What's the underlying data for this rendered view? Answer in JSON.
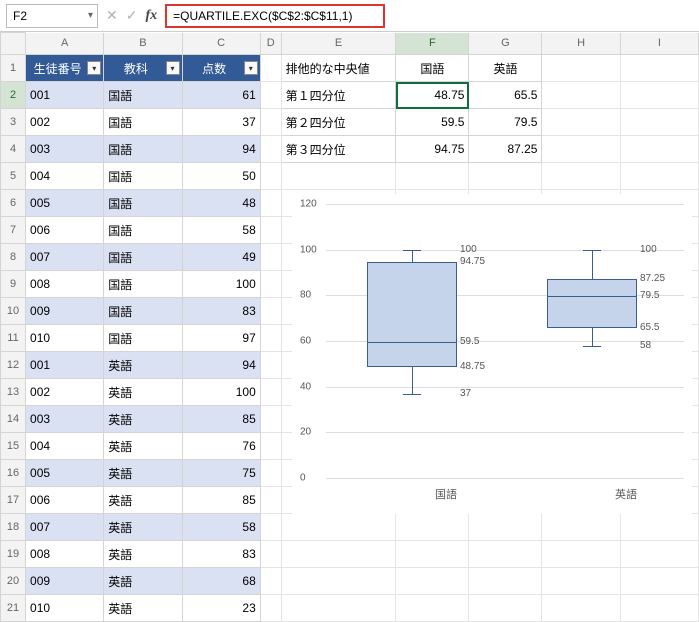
{
  "name_box": "F2",
  "formula": "=QUARTILE.EXC($C$2:$C$11,1)",
  "col_headers": [
    "A",
    "B",
    "C",
    "D",
    "E",
    "F",
    "G",
    "H",
    "I"
  ],
  "table_headers": {
    "A": "生徒番号",
    "B": "教科",
    "C": "点数"
  },
  "rows": [
    {
      "n": "1"
    },
    {
      "n": "2",
      "A": "001",
      "B": "国語",
      "C": "61",
      "E": "第１四分位",
      "F": "48.75",
      "G": "65.5",
      "band": true
    },
    {
      "n": "3",
      "A": "002",
      "B": "国語",
      "C": "37",
      "E": "第２四分位",
      "F": "59.5",
      "G": "79.5"
    },
    {
      "n": "4",
      "A": "003",
      "B": "国語",
      "C": "94",
      "E": "第３四分位",
      "F": "94.75",
      "G": "87.25",
      "band": true
    },
    {
      "n": "5",
      "A": "004",
      "B": "国語",
      "C": "50"
    },
    {
      "n": "6",
      "A": "005",
      "B": "国語",
      "C": "48",
      "band": true
    },
    {
      "n": "7",
      "A": "006",
      "B": "国語",
      "C": "58"
    },
    {
      "n": "8",
      "A": "007",
      "B": "国語",
      "C": "49",
      "band": true
    },
    {
      "n": "9",
      "A": "008",
      "B": "国語",
      "C": "100"
    },
    {
      "n": "10",
      "A": "009",
      "B": "国語",
      "C": "83",
      "band": true
    },
    {
      "n": "11",
      "A": "010",
      "B": "国語",
      "C": "97"
    },
    {
      "n": "12",
      "A": "001",
      "B": "英語",
      "C": "94",
      "band": true
    },
    {
      "n": "13",
      "A": "002",
      "B": "英語",
      "C": "100"
    },
    {
      "n": "14",
      "A": "003",
      "B": "英語",
      "C": "85",
      "band": true
    },
    {
      "n": "15",
      "A": "004",
      "B": "英語",
      "C": "76"
    },
    {
      "n": "16",
      "A": "005",
      "B": "英語",
      "C": "75",
      "band": true
    },
    {
      "n": "17",
      "A": "006",
      "B": "英語",
      "C": "85"
    },
    {
      "n": "18",
      "A": "007",
      "B": "英語",
      "C": "58",
      "band": true
    },
    {
      "n": "19",
      "A": "008",
      "B": "英語",
      "C": "83"
    },
    {
      "n": "20",
      "A": "009",
      "B": "英語",
      "C": "68",
      "band": true
    },
    {
      "n": "21",
      "A": "010",
      "B": "英語",
      "C": "23"
    }
  ],
  "summary_header": {
    "E": "排他的な中央値",
    "F": "国語",
    "G": "英語"
  },
  "chart_data": {
    "type": "boxplot",
    "categories": [
      "国語",
      "英語"
    ],
    "series": [
      {
        "name": "国語",
        "min": 37,
        "q1": 48.75,
        "median": 59.5,
        "q3": 94.75,
        "max": 100,
        "labels": [
          "100",
          "94.75",
          "59.5",
          "48.75",
          "37"
        ]
      },
      {
        "name": "英語",
        "min": 58,
        "q1": 65.5,
        "median": 79.5,
        "q3": 87.25,
        "max": 100,
        "labels": [
          "100",
          "87.25",
          "79.5",
          "65.5",
          "58"
        ]
      }
    ],
    "ylim": [
      0,
      120
    ],
    "yticks": [
      0,
      20,
      40,
      60,
      80,
      100,
      120
    ],
    "xlabel": "",
    "ylabel": "",
    "title": ""
  }
}
